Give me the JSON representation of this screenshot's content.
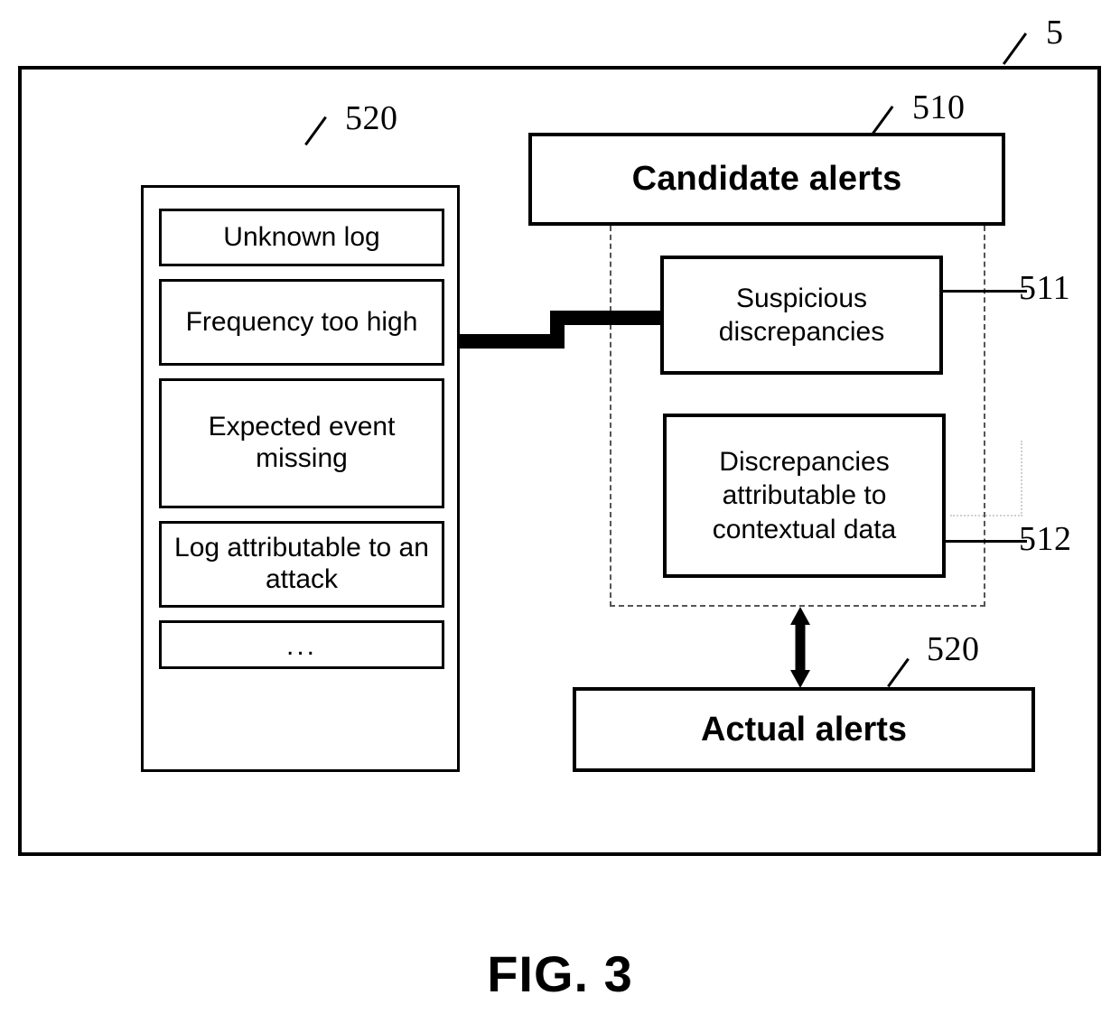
{
  "figure": {
    "caption": "FIG. 3",
    "frame_ref": "5"
  },
  "left_panel": {
    "ref": "520",
    "criteria": [
      {
        "label": "Unknown log"
      },
      {
        "label": "Frequency too high"
      },
      {
        "label": "Expected event missing"
      },
      {
        "label": "Log attributable to an attack"
      },
      {
        "label": "..."
      }
    ]
  },
  "candidate_alerts": {
    "title": "Candidate alerts",
    "ref": "510",
    "categories": [
      {
        "label": "Suspicious discrepancies",
        "ref": "511"
      },
      {
        "label": "Discrepancies attributable to contextual data",
        "ref": "512"
      }
    ]
  },
  "actual_alerts": {
    "title": "Actual alerts",
    "ref": "520"
  },
  "colors": {
    "ink": "#000000",
    "paper": "#ffffff",
    "dashed_group": "#555555",
    "artifact": "#cfcfcf"
  }
}
